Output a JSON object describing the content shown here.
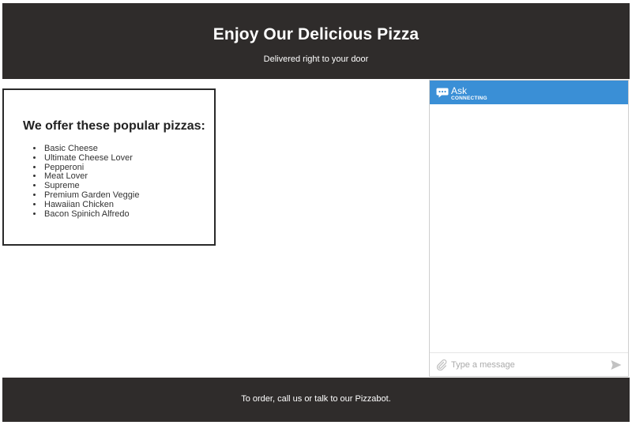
{
  "header": {
    "title": "Enjoy Our Delicious Pizza",
    "subtitle": "Delivered right to your door"
  },
  "menu": {
    "heading": "We offer these popular pizzas:",
    "items": [
      "Basic Cheese",
      "Ultimate Cheese Lover",
      "Pepperoni",
      "Meat Lover",
      "Supreme",
      "Premium Garden Veggie",
      "Hawaiian Chicken",
      "Bacon Spinich Alfredo"
    ]
  },
  "chat": {
    "title": "Ask",
    "status": "CONNECTING",
    "input_placeholder": "Type a message",
    "icons": {
      "header": "chat-bubble-icon",
      "attach": "paperclip-icon",
      "send": "send-icon"
    },
    "colors": {
      "header_bg": "#3a8fd6"
    }
  },
  "footer": {
    "text": "To order, call us or talk to our Pizzabot."
  },
  "colors": {
    "banner_bg": "#2f2c2b",
    "banner_text": "#ffffff"
  }
}
